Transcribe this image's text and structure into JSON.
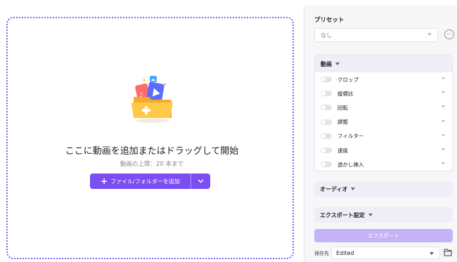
{
  "left": {
    "drop_title": "ここに動画を追加またはドラッグして開始",
    "drop_limit": "動画の上限：20 本まで",
    "add_button_label": "ファイル/フォルダーを追加",
    "add_icon": "plus-icon",
    "dropdown_icon": "chevron-down-icon"
  },
  "right": {
    "preset_label": "プリセット",
    "preset_value": "なし",
    "more_icon": "more-icon",
    "video_section": {
      "title": "動画",
      "options": [
        {
          "label": "クロップ"
        },
        {
          "label": "縦横比"
        },
        {
          "label": "回転"
        },
        {
          "label": "調整"
        },
        {
          "label": "フィルター"
        },
        {
          "label": "速度"
        },
        {
          "label": "透かし挿入"
        }
      ]
    },
    "audio_section_title": "オーディオ",
    "export_settings_title": "エクスポート設定",
    "export_button_label": "エクスポート",
    "save_label": "保存先",
    "save_value": "Edited",
    "folder_icon": "folder-icon"
  },
  "colors": {
    "accent": "#7a4ef0",
    "accent_disabled": "#c5b3f5",
    "dropzone_border": "#8a5cf6",
    "panel_header": "#efedf6"
  }
}
